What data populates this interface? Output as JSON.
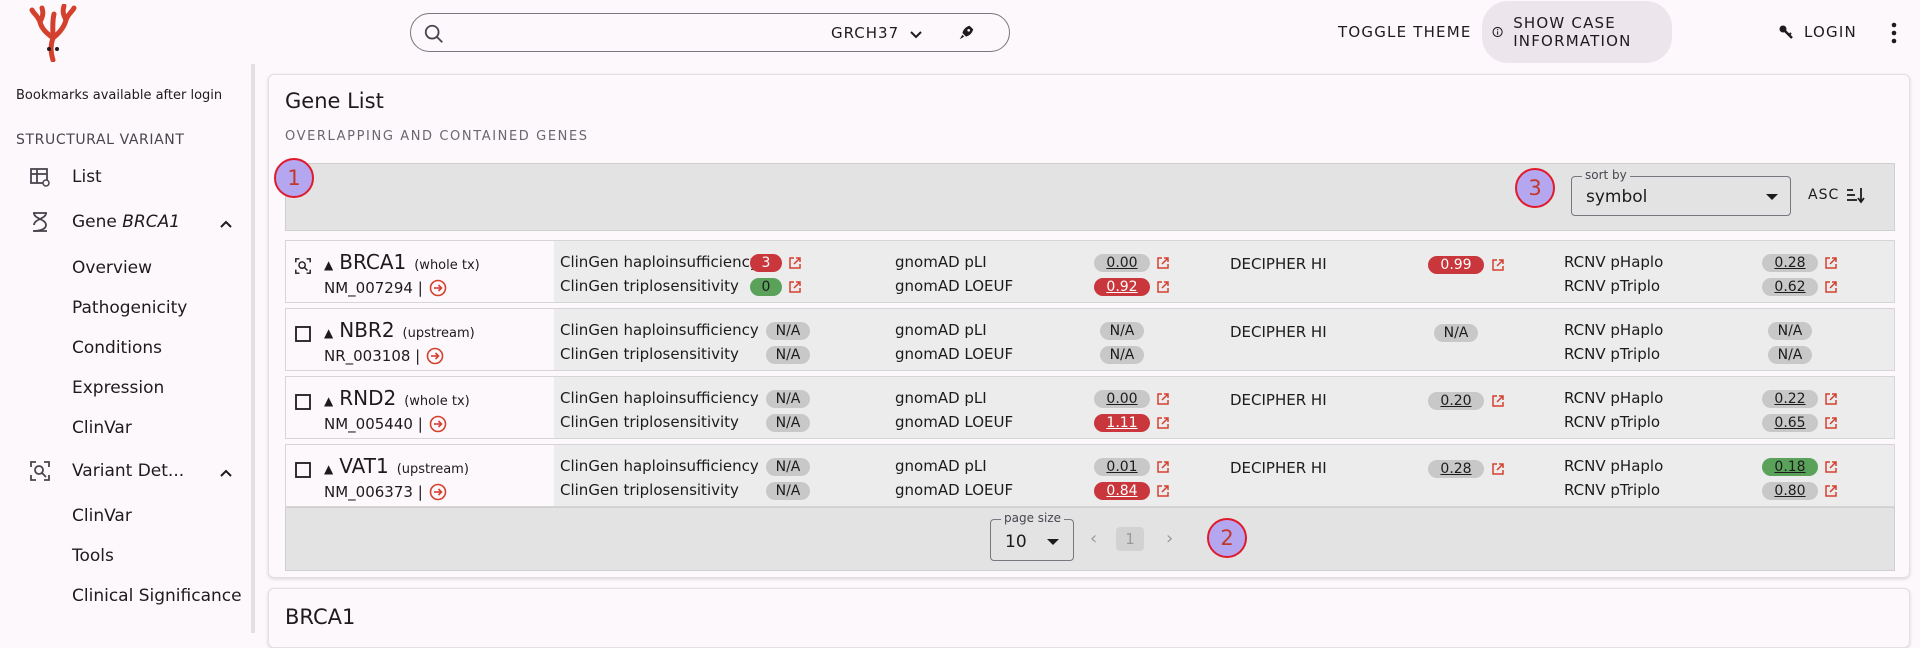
{
  "header": {
    "search_placeholder": "",
    "genome_release": "GRCH37",
    "toggle_theme": "TOGGLE THEME",
    "show_case_info": "SHOW CASE INFORMATION",
    "login": "LOGIN"
  },
  "sidebar": {
    "bookmarks_note": "Bookmarks available after login",
    "section": "STRUCTURAL VARIANT",
    "items": [
      {
        "label": "List"
      },
      {
        "label_prefix": "Gene ",
        "label_gene": "BRCA1"
      },
      {
        "label": "Overview"
      },
      {
        "label": "Pathogenicity"
      },
      {
        "label": "Conditions"
      },
      {
        "label": "Expression"
      },
      {
        "label": "ClinVar"
      },
      {
        "label": "Variant Det..."
      },
      {
        "label": "ClinVar"
      },
      {
        "label": "Tools"
      },
      {
        "label": "Clinical Significance"
      }
    ]
  },
  "gene_list": {
    "title": "Gene List",
    "subtitle": "OVERLAPPING AND CONTAINED GENES",
    "markers": [
      "1",
      "2",
      "3"
    ],
    "sort_by_label": "sort by",
    "sort_by_value": "symbol",
    "order_label": "ASC",
    "labels": {
      "clingen_hi": "ClinGen haploinsufficiency",
      "clingen_ts": "ClinGen triplosensitivity",
      "gnomad_pli": "gnomAD pLI",
      "gnomad_loeuf": "gnomAD LOEUF",
      "decipher_hi": "DECIPHER HI",
      "rcnv_phaplo": "RCNV pHaplo",
      "rcnv_ptriplo": "RCNV pTriplo"
    },
    "rows": [
      {
        "symbol": "BRCA1",
        "relation": "(whole tx)",
        "tx": "NM_007294 |",
        "hi": "3",
        "ts": "0",
        "pli": "0.00",
        "loeuf": "0.92",
        "decipher": "0.99",
        "phaplo": "0.28",
        "ptriplo": "0.62"
      },
      {
        "symbol": "NBR2",
        "relation": "(upstream)",
        "tx": "NR_003108 |",
        "hi": "N/A",
        "ts": "N/A",
        "pli": "N/A",
        "loeuf": "N/A",
        "decipher": "N/A",
        "phaplo": "N/A",
        "ptriplo": "N/A"
      },
      {
        "symbol": "RND2",
        "relation": "(whole tx)",
        "tx": "NM_005440 |",
        "hi": "N/A",
        "ts": "N/A",
        "pli": "0.00",
        "loeuf": "1.11",
        "decipher": "0.20",
        "phaplo": "0.22",
        "ptriplo": "0.65"
      },
      {
        "symbol": "VAT1",
        "relation": "(upstream)",
        "tx": "NM_006373 |",
        "hi": "N/A",
        "ts": "N/A",
        "pli": "0.01",
        "loeuf": "0.84",
        "decipher": "0.28",
        "phaplo": "0.18",
        "ptriplo": "0.80"
      }
    ],
    "page_size_label": "page size",
    "page_size": "10",
    "current_page": "1"
  },
  "next_card": {
    "title": "BRCA1"
  },
  "colors": {
    "accent_red": "#c9363b",
    "accent_green": "#5aa25a",
    "marker_fill": "#b5a6f0"
  }
}
